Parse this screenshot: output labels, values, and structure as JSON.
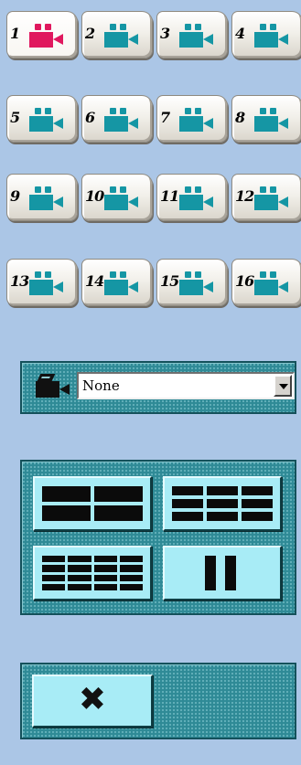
{
  "cameras": [
    {
      "number": "1",
      "active": true
    },
    {
      "number": "2",
      "active": false
    },
    {
      "number": "3",
      "active": false
    },
    {
      "number": "4",
      "active": false
    },
    {
      "number": "5",
      "active": false
    },
    {
      "number": "6",
      "active": false
    },
    {
      "number": "7",
      "active": false
    },
    {
      "number": "8",
      "active": false
    },
    {
      "number": "9",
      "active": false
    },
    {
      "number": "10",
      "active": false
    },
    {
      "number": "11",
      "active": false
    },
    {
      "number": "12",
      "active": false
    },
    {
      "number": "13",
      "active": false
    },
    {
      "number": "14",
      "active": false
    },
    {
      "number": "15",
      "active": false
    },
    {
      "number": "16",
      "active": false
    }
  ],
  "camera_select": {
    "value": "None",
    "icon": "film-camera-icon"
  },
  "layouts": [
    {
      "icon": "layout-4-split-icon"
    },
    {
      "icon": "layout-9-split-icon"
    },
    {
      "icon": "layout-16-split-icon"
    },
    {
      "icon": "layout-pause-icon"
    }
  ],
  "close_button": {
    "symbol": "✖",
    "icon": "close-icon"
  },
  "colors": {
    "background": "#abc6e6",
    "active_camera": "#e0185e",
    "inactive_camera": "#1596a4",
    "panel": "#2f8a96",
    "panel_button": "#a8ecf6"
  }
}
